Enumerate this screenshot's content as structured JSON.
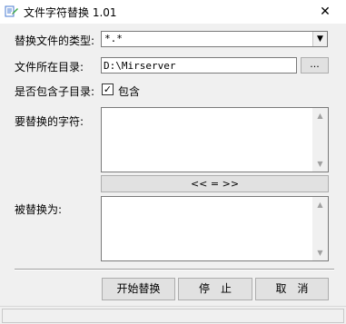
{
  "window": {
    "title": "文件字符替换 1.01",
    "close_symbol": "✕"
  },
  "form": {
    "type_label": "替换文件的类型:",
    "type_value": "*.*",
    "dir_label": "文件所在目录:",
    "dir_value": "D:\\Mirserver",
    "browse_label": "...",
    "subdir_label": "是否包含子目录:",
    "subdir_checked": true,
    "subdir_check_label": "包含",
    "find_label": "要替换的字符:",
    "find_value": "",
    "swap_label": "<< = >>",
    "replace_label": "被替换为:",
    "replace_value": ""
  },
  "actions": {
    "start_label": "开始替换",
    "stop_label": "停　止",
    "cancel_label": "取　消"
  },
  "statusbar": {
    "text": ""
  },
  "icons": {
    "app": "app-icon",
    "dropdown": "chevron-down-icon",
    "scroll_up": "scroll-up-icon",
    "scroll_down": "scroll-down-icon"
  }
}
